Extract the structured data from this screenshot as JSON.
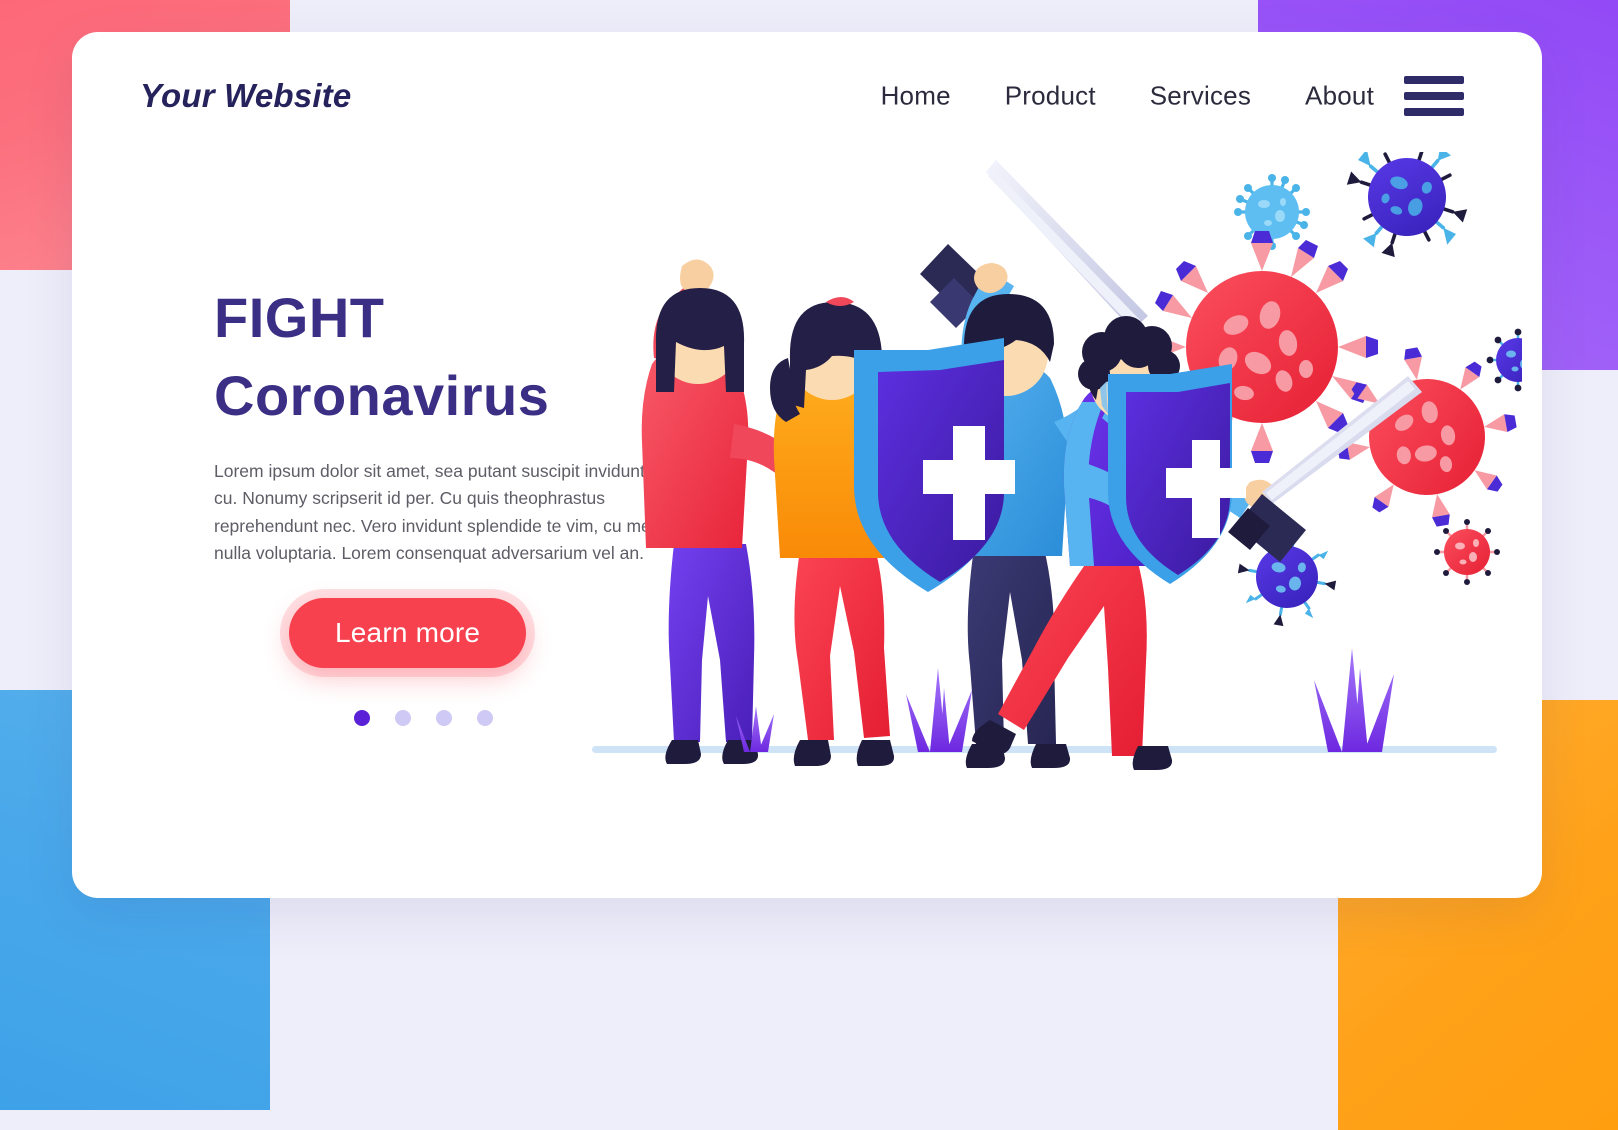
{
  "theme": {
    "page_background": "#eeeefa",
    "card_background": "#ffffff",
    "heading_color": "#3b2f85",
    "logo_color": "#26235c",
    "accent_red": "#f8414f",
    "nav_color": "#2b2b3d",
    "body_text_color": "#5d5d66",
    "dot_active": "#5b21d6",
    "dot_inactive": "#cfc9f5",
    "corner_top_left": "#fc6f7d",
    "corner_top_right": "#9a56f7",
    "corner_bottom_left": "#49a8ea",
    "corner_bottom_right": "#ffa21a"
  },
  "header": {
    "logo": "Your Website",
    "nav": [
      {
        "label": "Home"
      },
      {
        "label": "Product"
      },
      {
        "label": "Services"
      },
      {
        "label": "About"
      }
    ],
    "menu_icon": "hamburger-menu-icon"
  },
  "hero": {
    "title_line1": "FIGHT",
    "title_line2": "Coronavirus",
    "paragraph": "Lorem ipsum dolor sit amet, sea putant suscipit invidunt cu. Nonumy scripserit id per. Cu quis theophrastus reprehendunt nec. Vero invidunt splendide te vim, cu mea nulla voluptaria. Lorem consenquat adversarium vel an.",
    "cta_label": "Learn more",
    "carousel": {
      "total": 4,
      "active_index": 0
    }
  },
  "illustration": {
    "name": "people-fighting-coronavirus-illustration",
    "characters": [
      {
        "name": "woman-raised-fist",
        "top": "#f0475a",
        "bottom": "#6028d8",
        "hair": "#241f46"
      },
      {
        "name": "woman-ponytail-orange",
        "top": "#fb9a12",
        "bottom": "#f6303f",
        "hair": "#241f46"
      },
      {
        "name": "man-with-sword-and-shield",
        "top": "#3ba0e8",
        "bottom": "#2d2c5e",
        "hair": "#1e1b3d"
      },
      {
        "name": "man-with-mask-shield-sword",
        "top": "#5b2fd6",
        "bottom": "#f6303f",
        "hair": "#1e1b3d",
        "mask": "#a9d4ef"
      }
    ],
    "shields": {
      "face": "#4a2bbf",
      "edge": "#3ba0e8",
      "cross": "#ffffff"
    },
    "swords": {
      "blade": "#dadcf0",
      "hilt": "#2b2a55"
    },
    "viruses": [
      {
        "name": "virus-red-large",
        "color": "#f5414f"
      },
      {
        "name": "virus-red-medium",
        "color": "#f5414f"
      },
      {
        "name": "virus-red-small",
        "color": "#f5414f"
      },
      {
        "name": "virus-blue-light",
        "color": "#4ab3e8"
      },
      {
        "name": "virus-purple-large",
        "color": "#4a2bd6"
      },
      {
        "name": "virus-purple-small",
        "color": "#4a2bd6"
      },
      {
        "name": "virus-blue-dark",
        "color": "#3a2bd0"
      }
    ],
    "grass_color": "#8b5cf6",
    "ground_color": "#cfe3f7"
  }
}
